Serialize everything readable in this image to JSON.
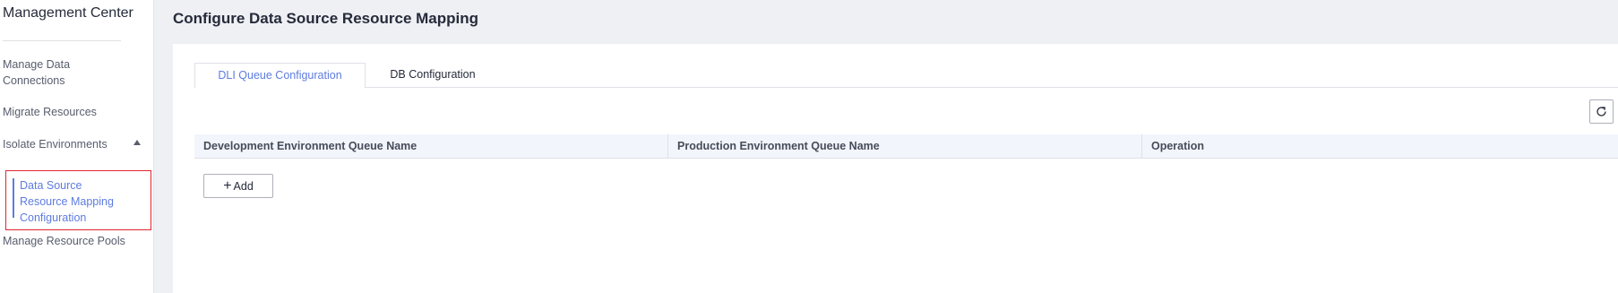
{
  "sidebar": {
    "title": "Management Center",
    "items": [
      {
        "label": "Manage Data Connections"
      },
      {
        "label": "Migrate Resources"
      },
      {
        "label": "Isolate Environments",
        "expanded": true
      },
      {
        "label": "Data Source Resource Mapping Configuration",
        "selected": true
      },
      {
        "label": "Manage Resource Pools"
      }
    ]
  },
  "page": {
    "title": "Configure Data Source Resource Mapping"
  },
  "tabs": [
    {
      "label": "DLI Queue Configuration",
      "active": true
    },
    {
      "label": "DB Configuration",
      "active": false
    }
  ],
  "table": {
    "columns": [
      "Development Environment Queue Name",
      "Production Environment Queue Name",
      "Operation"
    ],
    "rows": []
  },
  "actions": {
    "add_label": "Add",
    "refresh_icon": "refresh-icon"
  },
  "colors": {
    "accent": "#5e7ce0",
    "highlight_border": "#e0262f",
    "background": "#eef0f4"
  }
}
